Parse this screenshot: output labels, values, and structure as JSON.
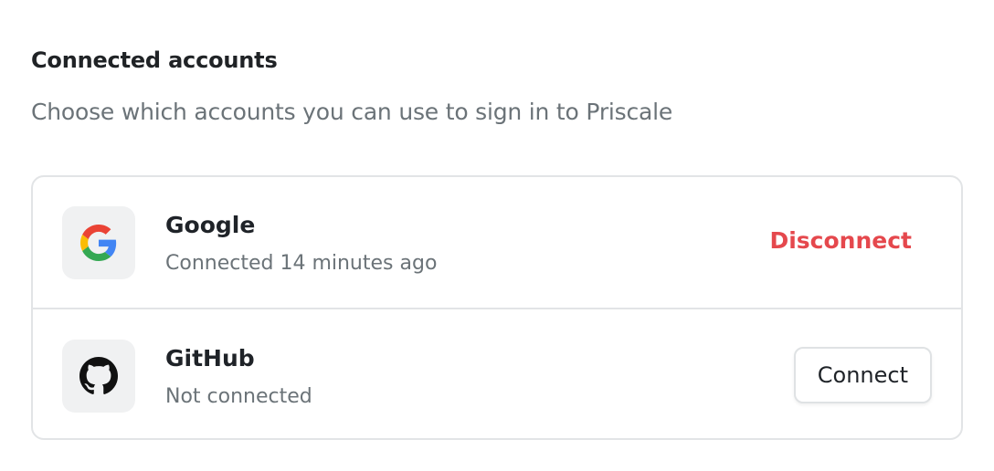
{
  "section": {
    "title": "Connected accounts",
    "subtitle": "Choose which accounts you can use to sign in to Priscale"
  },
  "accounts": [
    {
      "name": "Google",
      "status": "Connected 14 minutes ago",
      "icon": "google-icon",
      "action_label": "Disconnect",
      "action_color": "#e5484d"
    },
    {
      "name": "GitHub",
      "status": "Not connected",
      "icon": "github-icon",
      "action_label": "Connect"
    }
  ]
}
